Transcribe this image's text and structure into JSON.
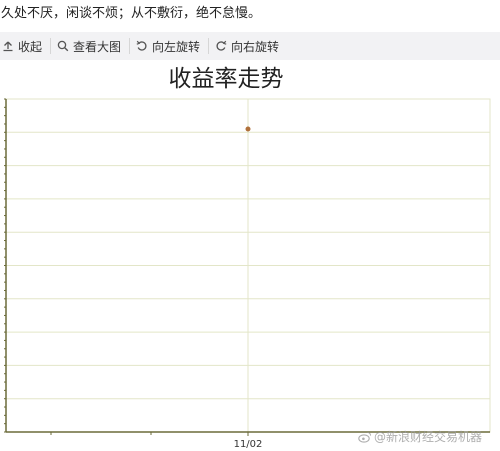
{
  "quote_text": "久处不厌，闲谈不烦；从不敷衍，绝不怠慢。",
  "toolbar": {
    "items": [
      {
        "label": "收起",
        "icon": "collapse-up-icon"
      },
      {
        "label": "查看大图",
        "icon": "magnifier-icon"
      },
      {
        "label": "向左旋转",
        "icon": "rotate-left-icon"
      },
      {
        "label": "向右旋转",
        "icon": "rotate-right-icon"
      }
    ]
  },
  "chart_data": {
    "type": "scatter",
    "title": "收益率走势",
    "xlabel": "",
    "ylabel": "",
    "x_ticks": [
      "11/02"
    ],
    "points": [
      {
        "x": "11/02",
        "y": 0.91
      }
    ],
    "ylim": [
      0,
      1
    ],
    "grid": true,
    "grid_color": "#e3e6c8",
    "axis_color": "#6b6b3a",
    "point_color": "#b0703a"
  },
  "watermark": {
    "text": "@新浪财经交易机器",
    "icon": "weibo-icon"
  }
}
